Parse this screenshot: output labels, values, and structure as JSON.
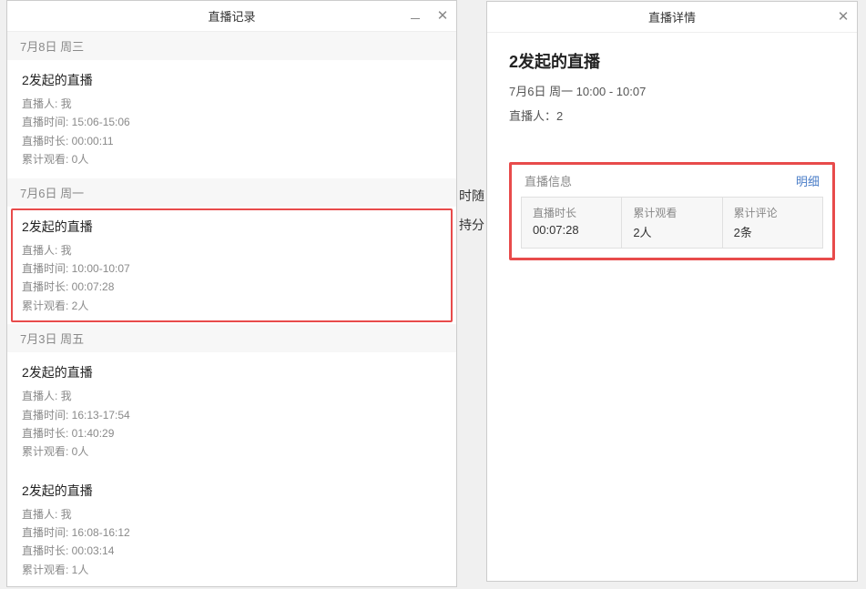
{
  "records_window": {
    "title": "直播记录",
    "groups": [
      {
        "date": "7月8日 周三",
        "items": [
          {
            "title": "2发起的直播",
            "host_label": "直播人:",
            "host_value": "我",
            "time_label": "直播时间:",
            "time_value": "15:06-15:06",
            "duration_label": "直播时长:",
            "duration_value": "00:00:11",
            "views_label": "累计观看:",
            "views_value": "0人",
            "selected": false
          }
        ]
      },
      {
        "date": "7月6日 周一",
        "items": [
          {
            "title": "2发起的直播",
            "host_label": "直播人:",
            "host_value": "我",
            "time_label": "直播时间:",
            "time_value": "10:00-10:07",
            "duration_label": "直播时长:",
            "duration_value": "00:07:28",
            "views_label": "累计观看:",
            "views_value": "2人",
            "selected": true
          }
        ]
      },
      {
        "date": "7月3日 周五",
        "items": [
          {
            "title": "2发起的直播",
            "host_label": "直播人:",
            "host_value": "我",
            "time_label": "直播时间:",
            "time_value": "16:13-17:54",
            "duration_label": "直播时长:",
            "duration_value": "01:40:29",
            "views_label": "累计观看:",
            "views_value": "0人",
            "selected": false
          },
          {
            "title": "2发起的直播",
            "host_label": "直播人:",
            "host_value": "我",
            "time_label": "直播时间:",
            "time_value": "16:08-16:12",
            "duration_label": "直播时长:",
            "duration_value": "00:03:14",
            "views_label": "累计观看:",
            "views_value": "1人",
            "selected": false
          }
        ]
      }
    ]
  },
  "details_window": {
    "title": "直播详情",
    "heading": "2发起的直播",
    "subtitle": "7月6日 周一 10:00 - 10:07",
    "host_line": "直播人：2",
    "info_header": "直播信息",
    "detail_link": "明细",
    "cells": [
      {
        "label": "直播时长",
        "value": "00:07:28"
      },
      {
        "label": "累计观看",
        "value": "2人"
      },
      {
        "label": "累计评论",
        "value": "2条"
      }
    ]
  },
  "bg": {
    "t1": "时随",
    "t2": "持分"
  }
}
